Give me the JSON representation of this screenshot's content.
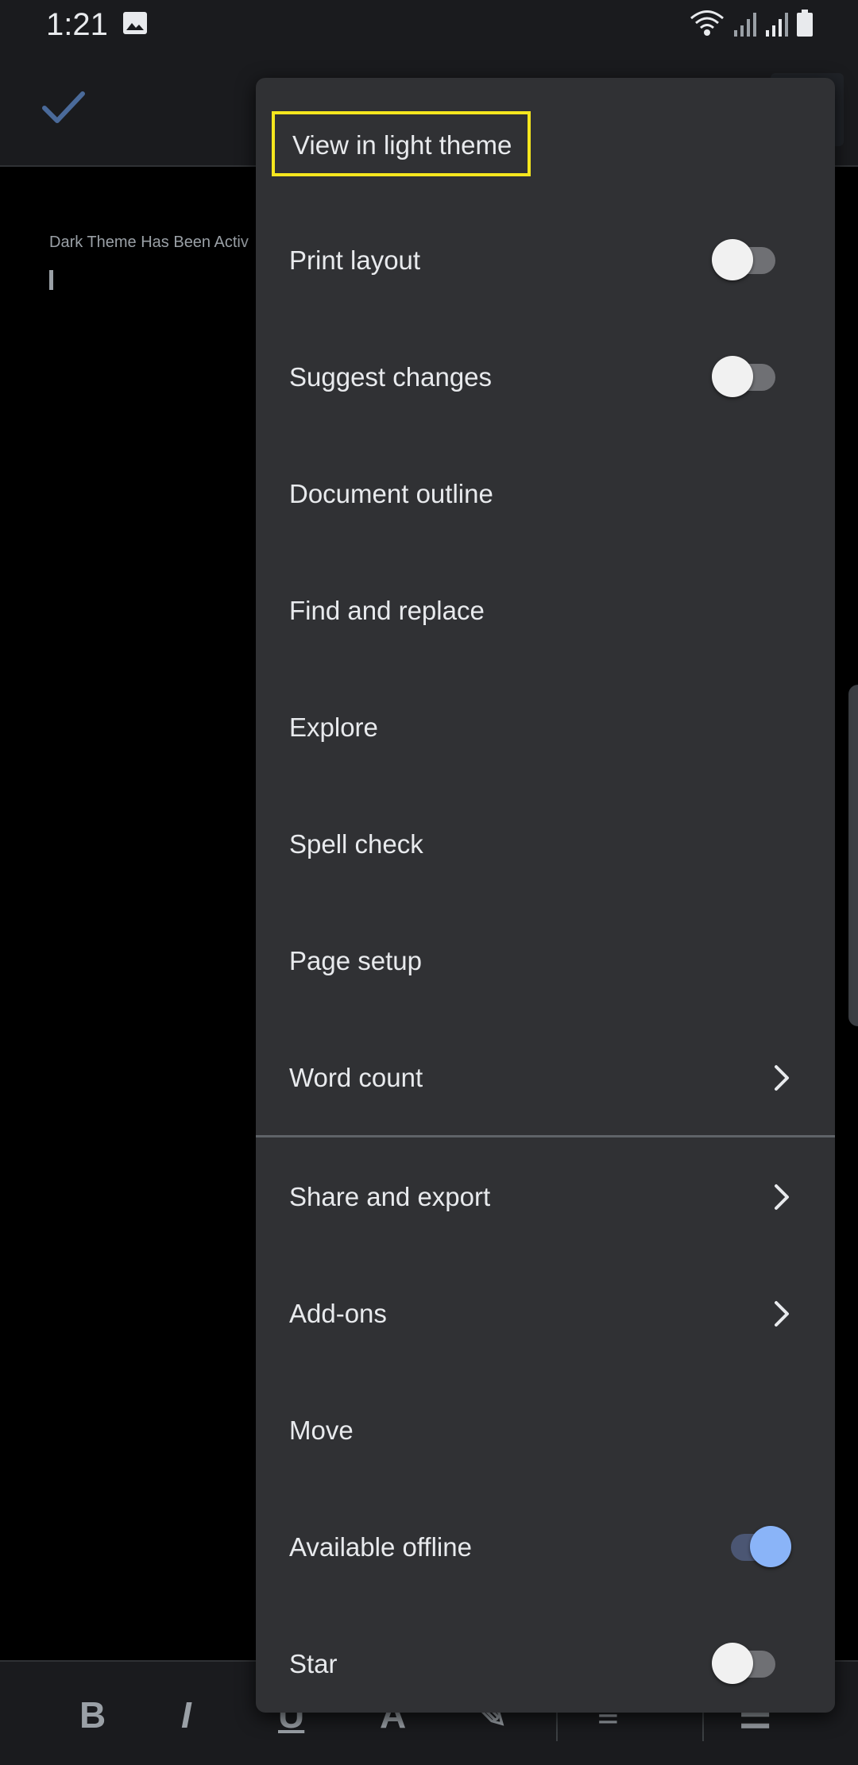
{
  "status_bar": {
    "time": "1:21"
  },
  "document": {
    "body_text": "Dark Theme Has Been Activ"
  },
  "overflow_menu": {
    "items": [
      {
        "label": "View in light theme",
        "highlighted": true
      },
      {
        "label": "Print layout",
        "toggle": "off"
      },
      {
        "label": "Suggest changes",
        "toggle": "off"
      },
      {
        "label": "Document outline"
      },
      {
        "label": "Find and replace"
      },
      {
        "label": "Explore"
      },
      {
        "label": "Spell check"
      },
      {
        "label": "Page setup"
      },
      {
        "label": "Word count",
        "submenu": true
      },
      {
        "label": "Share and export",
        "submenu": true
      },
      {
        "label": "Add-ons",
        "submenu": true
      },
      {
        "label": "Move"
      },
      {
        "label": "Available offline",
        "toggle": "on"
      },
      {
        "label": "Star",
        "toggle": "off"
      }
    ]
  },
  "colors": {
    "highlight_border": "#f5e61e",
    "toggle_on": "#8ab4f8",
    "menu_background": "#303134"
  }
}
